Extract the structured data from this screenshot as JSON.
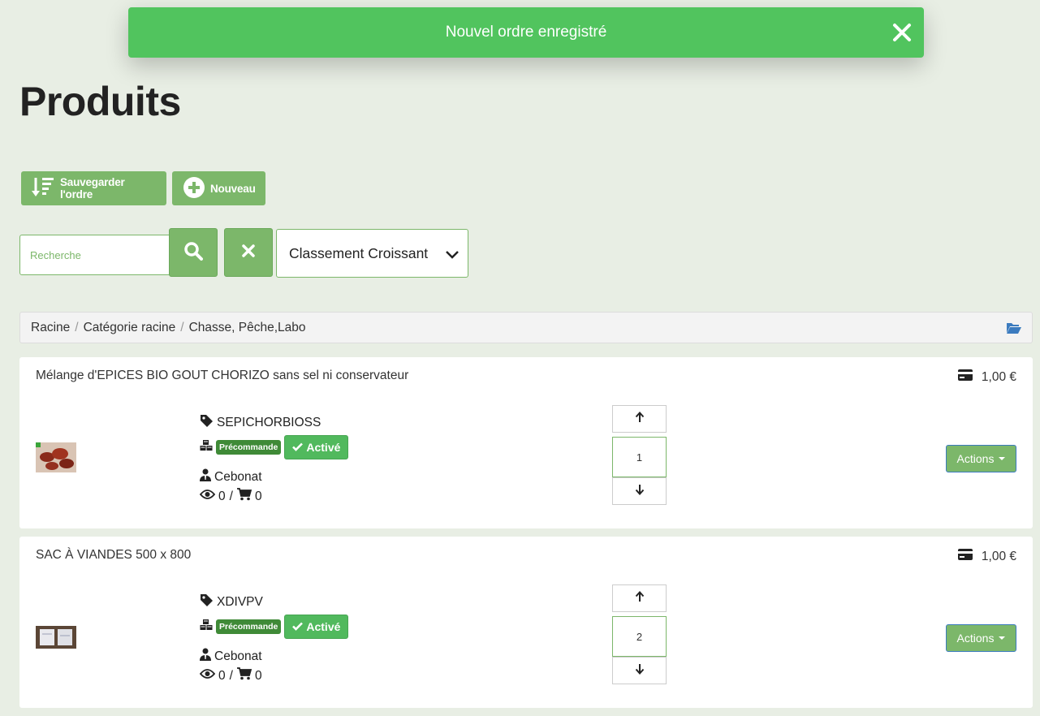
{
  "toast": {
    "message": "Nouvel ordre enregistré"
  },
  "page": {
    "title": "Produits"
  },
  "toolbar": {
    "save_order_label": "Sauvegarder l'ordre",
    "new_label": "Nouveau"
  },
  "search": {
    "placeholder": "Recherche",
    "value": ""
  },
  "sort": {
    "selected": "Classement Croissant"
  },
  "breadcrumb": [
    "Racine",
    "Catégorie racine",
    "Chasse, Pêche,Labo"
  ],
  "colors": {
    "primary": "#7cb76a",
    "toast": "#51c45e",
    "badge_dark": "#3f8a37",
    "badge_active": "#51b95d",
    "background": "#e8eee4"
  },
  "products": [
    {
      "name": "Mélange d'EPICES BIO GOUT CHORIZO sans sel ni conservateur",
      "price": "1,00 €",
      "sku": "SEPICHORBIOSS",
      "preorder_label": "Précommande",
      "active_label": "Activé",
      "owner": "Cebonat",
      "views": "0",
      "sep": "/",
      "cart": "0",
      "order": "1",
      "actions_label": "Actions"
    },
    {
      "name": "SAC À VIANDES 500 x 800",
      "price": "1,00 €",
      "sku": "XDIVPV",
      "preorder_label": "Précommande",
      "active_label": "Activé",
      "owner": "Cebonat",
      "views": "0",
      "sep": "/",
      "cart": "0",
      "order": "2",
      "actions_label": "Actions"
    }
  ]
}
